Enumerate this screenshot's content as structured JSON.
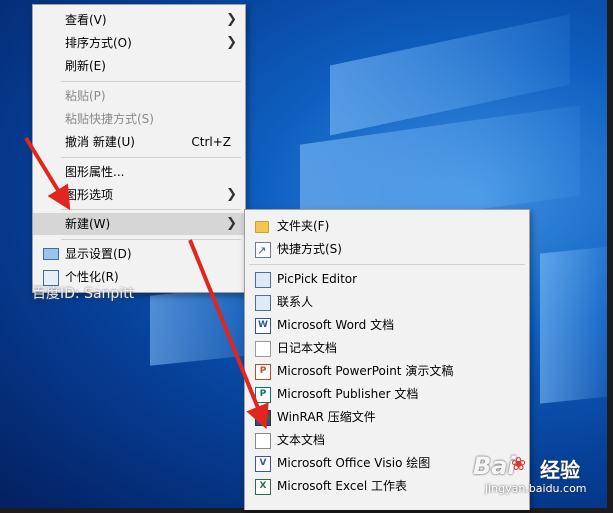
{
  "context_menu": {
    "items": [
      {
        "label": "查看(V)",
        "submenu": true
      },
      {
        "label": "排序方式(O)",
        "submenu": true
      },
      {
        "label": "刷新(E)"
      },
      {
        "label": "粘贴(P)",
        "disabled": true
      },
      {
        "label": "粘贴快捷方式(S)",
        "disabled": true
      },
      {
        "label": "撤消 新建(U)",
        "shortcut": "Ctrl+Z"
      },
      {
        "label": "图形属性..."
      },
      {
        "label": "图形选项",
        "submenu": true
      },
      {
        "label": "新建(W)",
        "submenu": true,
        "highlighted": true
      },
      {
        "label": "显示设置(D)",
        "icon": "display-settings-icon"
      },
      {
        "label": "个性化(R)",
        "icon": "personalize-icon"
      }
    ]
  },
  "new_submenu": {
    "items": [
      {
        "label": "文件夹(F)",
        "icon": "folder-icon"
      },
      {
        "label": "快捷方式(S)",
        "icon": "shortcut-icon"
      },
      {
        "label": "PicPick Editor",
        "icon": "picpick-icon"
      },
      {
        "label": "联系人",
        "icon": "contact-icon"
      },
      {
        "label": "Microsoft Word 文档",
        "icon": "word-icon"
      },
      {
        "label": "日记本文档",
        "icon": "journal-icon"
      },
      {
        "label": "Microsoft PowerPoint 演示文稿",
        "icon": "powerpoint-icon"
      },
      {
        "label": "Microsoft Publisher 文档",
        "icon": "publisher-icon"
      },
      {
        "label": "WinRAR 压缩文件",
        "icon": "winrar-icon"
      },
      {
        "label": "文本文档",
        "icon": "text-document-icon"
      },
      {
        "label": "Microsoft Office Visio 绘图",
        "icon": "visio-icon"
      },
      {
        "label": "Microsoft Excel 工作表",
        "icon": "excel-icon"
      }
    ]
  },
  "watermarks": {
    "left": "百度ID: Sanpitt",
    "right_logo": "Bai",
    "right_brand": "经验",
    "right_url": "jingyan.baidu.com"
  },
  "colors": {
    "annotation_arrow": "#e0261f",
    "menu_background": "#f2f2f2",
    "highlight": "#d6d6d6"
  }
}
